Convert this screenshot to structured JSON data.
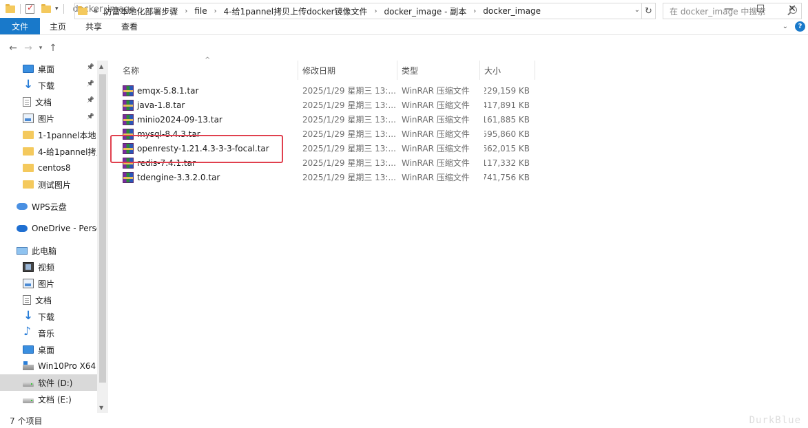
{
  "window": {
    "title": "docker_image",
    "controls": {
      "minimize": "—",
      "maximize": "☐",
      "close": "✕"
    }
  },
  "ribbon": {
    "tabs": [
      "文件",
      "主页",
      "共享",
      "查看"
    ]
  },
  "address": {
    "overflow": "«",
    "crumbs": [
      "防雷本地化部署步骤",
      "file",
      "4-给1pannel拷贝上传docker镜像文件",
      "docker_image - 副本",
      "docker_image"
    ],
    "search_placeholder": "在 docker_image 中搜索"
  },
  "sidebar": {
    "items": [
      {
        "label": "桌面",
        "icon": "desktop-icon",
        "pinned": true
      },
      {
        "label": "下载",
        "icon": "download-icon",
        "pinned": true
      },
      {
        "label": "文档",
        "icon": "document-icon",
        "pinned": true
      },
      {
        "label": "图片",
        "icon": "picture-icon",
        "pinned": true
      },
      {
        "label": "1-1pannel本地",
        "icon": "folder-icon"
      },
      {
        "label": "4-给1pannel拷贝",
        "icon": "folder-icon"
      },
      {
        "label": "centos8",
        "icon": "folder-icon"
      },
      {
        "label": "测试图片",
        "icon": "folder-icon"
      },
      {
        "label": "WPS云盘",
        "icon": "cloud-icon"
      },
      {
        "label": "OneDrive - Perso",
        "icon": "onedrive-icon"
      },
      {
        "label": "此电脑",
        "icon": "pc-icon"
      },
      {
        "label": "视频",
        "icon": "video-icon"
      },
      {
        "label": "图片",
        "icon": "picture-icon"
      },
      {
        "label": "文档",
        "icon": "document-icon"
      },
      {
        "label": "下载",
        "icon": "download-icon"
      },
      {
        "label": "音乐",
        "icon": "music-icon"
      },
      {
        "label": "桌面",
        "icon": "desktop-icon"
      },
      {
        "label": "Win10Pro X64",
        "icon": "windows-drive-icon"
      },
      {
        "label": "软件 (D:)",
        "icon": "drive-icon",
        "selected": true
      },
      {
        "label": "文档 (E:)",
        "icon": "drive-icon"
      }
    ]
  },
  "columns": [
    "名称",
    "修改日期",
    "类型",
    "大小"
  ],
  "files": [
    {
      "name": "emqx-5.8.1.tar",
      "date": "2025/1/29 星期三 13:...",
      "type": "WinRAR 压缩文件",
      "size": "229,159 KB"
    },
    {
      "name": "java-1.8.tar",
      "date": "2025/1/29 星期三 13:...",
      "type": "WinRAR 压缩文件",
      "size": "417,891 KB"
    },
    {
      "name": "minio2024-09-13.tar",
      "date": "2025/1/29 星期三 13:...",
      "type": "WinRAR 压缩文件",
      "size": "161,885 KB"
    },
    {
      "name": "mysql-8.4.3.tar",
      "date": "2025/1/29 星期三 13:...",
      "type": "WinRAR 压缩文件",
      "size": "595,860 KB"
    },
    {
      "name": "openresty-1.21.4.3-3-3-focal.tar",
      "date": "2025/1/29 星期三 13:...",
      "type": "WinRAR 压缩文件",
      "size": "662,015 KB"
    },
    {
      "name": "redis-7.4.1.tar",
      "date": "2025/1/29 星期三 13:...",
      "type": "WinRAR 压缩文件",
      "size": "117,332 KB"
    },
    {
      "name": "tdengine-3.3.2.0.tar",
      "date": "2025/1/29 星期三 13:...",
      "type": "WinRAR 压缩文件",
      "size": "741,756 KB"
    }
  ],
  "status": {
    "item_count": "7 个项目"
  },
  "watermark": "DurkBlue",
  "colors": {
    "accent": "#1979ca",
    "highlight_box": "#e0404e",
    "selected_bg": "#d9d9d9"
  }
}
